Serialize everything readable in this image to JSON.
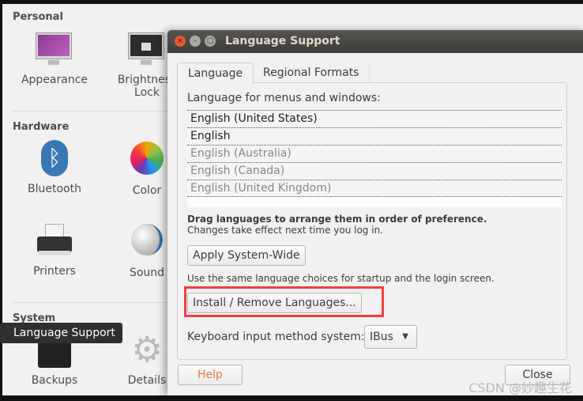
{
  "settings": {
    "sections": {
      "personal": "Personal",
      "hardware": "Hardware",
      "system": "System"
    },
    "items": {
      "appearance": "Appearance",
      "brightness": "Brightness",
      "brightness2": "Lock",
      "bluetooth": "Bluetooth",
      "color": "Color",
      "printers": "Printers",
      "sound": "Sound",
      "backups": "Backups",
      "details": "Details"
    },
    "tooltip": "Language Support"
  },
  "dialog": {
    "title": "Language Support",
    "tabs": [
      "Language",
      "Regional Formats"
    ],
    "list_label": "Language for menus and windows:",
    "languages": [
      "English (United States)",
      "English",
      "English (Australia)",
      "English (Canada)",
      "English (United Kingdom)"
    ],
    "drag_hint": "Drag languages to arrange them in order of preference.",
    "changes_hint": "Changes take effect next time you log in.",
    "apply_button": "Apply System-Wide",
    "apply_hint": "Use the same language choices for startup and the login screen.",
    "install_button": "Install / Remove Languages...",
    "keyboard_label": "Keyboard input method system:",
    "keyboard_value": "IBus",
    "help_button": "Help",
    "close_button": "Close"
  },
  "watermark": "CSDN @妙趣生花"
}
